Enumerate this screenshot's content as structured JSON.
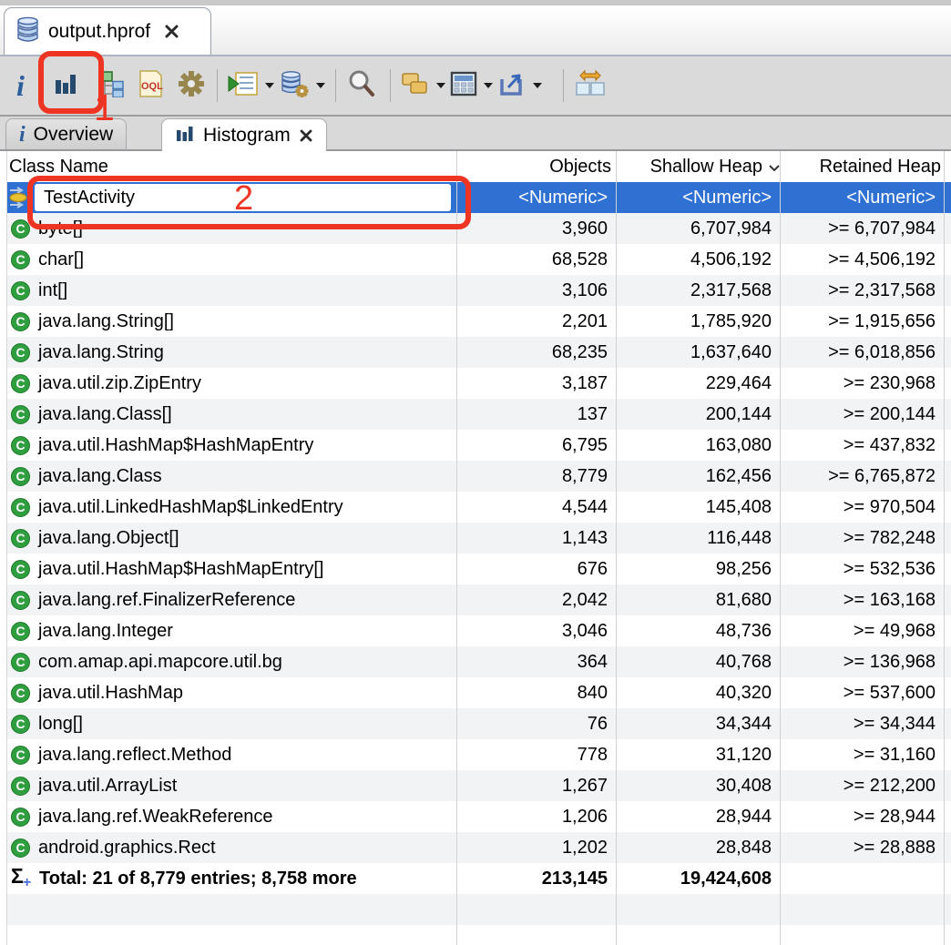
{
  "editor_tab": {
    "title": "output.hprof"
  },
  "toolbar": {
    "items": [
      "info",
      "histogram",
      "dominator-tree",
      "oql",
      "expert-features",
      "run-report",
      "query-browser",
      "search",
      "group-by",
      "calculator",
      "export",
      "compare"
    ],
    "oql_label": "OQL"
  },
  "view_tabs": {
    "overview": "Overview",
    "histogram": "Histogram"
  },
  "table": {
    "columns": {
      "class_name": "Class Name",
      "objects": "Objects",
      "shallow_heap": "Shallow Heap",
      "retained_heap": "Retained Heap"
    },
    "sort": {
      "column": "Shallow Heap",
      "direction": "descending"
    },
    "filter": {
      "class_name": "TestActivity",
      "numeric": "<Numeric>"
    },
    "class_icon_letter": "C",
    "rows": [
      {
        "class_name": "byte[]",
        "objects": "3,960",
        "shallow_heap": "6,707,984",
        "retained_heap": ">= 6,707,984"
      },
      {
        "class_name": "char[]",
        "objects": "68,528",
        "shallow_heap": "4,506,192",
        "retained_heap": ">= 4,506,192"
      },
      {
        "class_name": "int[]",
        "objects": "3,106",
        "shallow_heap": "2,317,568",
        "retained_heap": ">= 2,317,568"
      },
      {
        "class_name": "java.lang.String[]",
        "objects": "2,201",
        "shallow_heap": "1,785,920",
        "retained_heap": ">= 1,915,656"
      },
      {
        "class_name": "java.lang.String",
        "objects": "68,235",
        "shallow_heap": "1,637,640",
        "retained_heap": ">= 6,018,856"
      },
      {
        "class_name": "java.util.zip.ZipEntry",
        "objects": "3,187",
        "shallow_heap": "229,464",
        "retained_heap": ">= 230,968"
      },
      {
        "class_name": "java.lang.Class[]",
        "objects": "137",
        "shallow_heap": "200,144",
        "retained_heap": ">= 200,144"
      },
      {
        "class_name": "java.util.HashMap$HashMapEntry",
        "objects": "6,795",
        "shallow_heap": "163,080",
        "retained_heap": ">= 437,832"
      },
      {
        "class_name": "java.lang.Class",
        "objects": "8,779",
        "shallow_heap": "162,456",
        "retained_heap": ">= 6,765,872"
      },
      {
        "class_name": "java.util.LinkedHashMap$LinkedEntry",
        "objects": "4,544",
        "shallow_heap": "145,408",
        "retained_heap": ">= 970,504"
      },
      {
        "class_name": "java.lang.Object[]",
        "objects": "1,143",
        "shallow_heap": "116,448",
        "retained_heap": ">= 782,248"
      },
      {
        "class_name": "java.util.HashMap$HashMapEntry[]",
        "objects": "676",
        "shallow_heap": "98,256",
        "retained_heap": ">= 532,536"
      },
      {
        "class_name": "java.lang.ref.FinalizerReference",
        "objects": "2,042",
        "shallow_heap": "81,680",
        "retained_heap": ">= 163,168"
      },
      {
        "class_name": "java.lang.Integer",
        "objects": "3,046",
        "shallow_heap": "48,736",
        "retained_heap": ">= 49,968"
      },
      {
        "class_name": "com.amap.api.mapcore.util.bg",
        "objects": "364",
        "shallow_heap": "40,768",
        "retained_heap": ">= 136,968"
      },
      {
        "class_name": "java.util.HashMap",
        "objects": "840",
        "shallow_heap": "40,320",
        "retained_heap": ">= 537,600"
      },
      {
        "class_name": "long[]",
        "objects": "76",
        "shallow_heap": "34,344",
        "retained_heap": ">= 34,344"
      },
      {
        "class_name": "java.lang.reflect.Method",
        "objects": "778",
        "shallow_heap": "31,120",
        "retained_heap": ">= 31,160"
      },
      {
        "class_name": "java.util.ArrayList",
        "objects": "1,267",
        "shallow_heap": "30,408",
        "retained_heap": ">= 212,200"
      },
      {
        "class_name": "java.lang.ref.WeakReference",
        "objects": "1,206",
        "shallow_heap": "28,944",
        "retained_heap": ">= 28,944"
      },
      {
        "class_name": "android.graphics.Rect",
        "objects": "1,202",
        "shallow_heap": "28,848",
        "retained_heap": ">= 28,888"
      }
    ],
    "total": {
      "sigma": "Σ",
      "label": "Total: 21 of 8,779 entries; 8,758 more",
      "objects": "213,145",
      "shallow_heap": "19,424,608",
      "retained_heap": ""
    }
  },
  "annotations": {
    "step1": "1",
    "step2": "2",
    "color": "#ee3524"
  },
  "colors": {
    "selection_blue": "#2e71d3",
    "stripe": "#f2f3f5",
    "toolbar_gray": "#dadada",
    "annotation_red": "#ee3524",
    "class_icon_green": "#2f9e3f"
  }
}
